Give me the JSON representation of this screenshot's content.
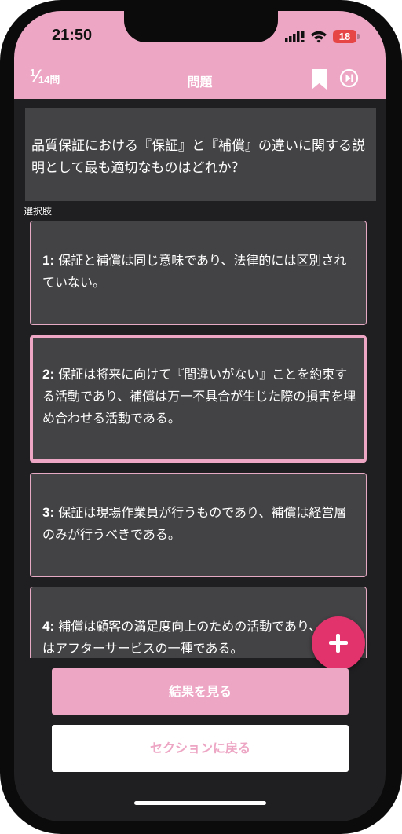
{
  "status_bar": {
    "time": "21:50",
    "battery": "18"
  },
  "header": {
    "current": "1",
    "total": "14",
    "total_unit": "問",
    "title": "問題"
  },
  "question": {
    "text": "品質保証における『保証』と『補償』の違いに関する説明として最も適切なものはどれか？"
  },
  "choices_label": "選択肢",
  "choices": [
    {
      "num": "1:",
      "text": "保証と補償は同じ意味であり、法律的には区別されていない。",
      "selected": false
    },
    {
      "num": "2:",
      "text": "保証は将来に向けて『間違いがない』ことを約束する活動であり、補償は万一不具合が生じた際の損害を埋め合わせる活動である。",
      "selected": true
    },
    {
      "num": "3:",
      "text": "保証は現場作業員が行うものであり、補償は経営層のみが行うべきである。",
      "selected": false
    },
    {
      "num": "4:",
      "text": "補償は顧客の満足度向上のための活動であり、保証はアフターサービスの一種である。",
      "selected": false
    }
  ],
  "buttons": {
    "result": "結果を見る",
    "back": "セクションに戻る"
  },
  "colors": {
    "accent": "#eda6c4",
    "fab": "#e2336d",
    "card": "#434244",
    "background": "#1f1f21"
  }
}
